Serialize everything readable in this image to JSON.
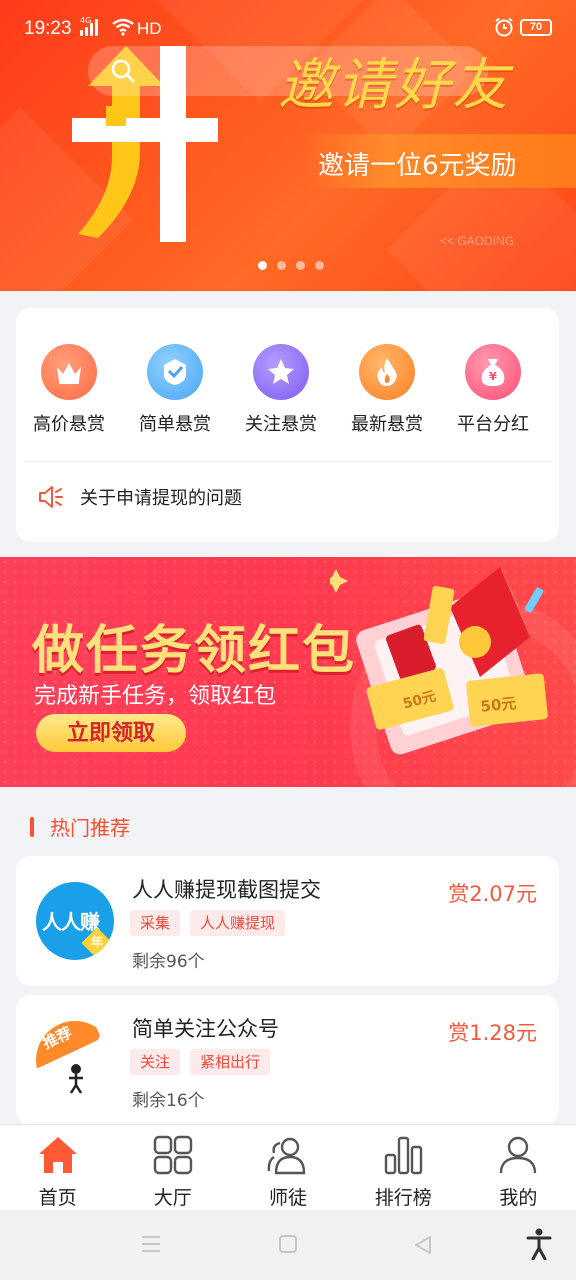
{
  "status_bar": {
    "time": "19:23",
    "network": "4G",
    "hd": "HD",
    "battery": "70"
  },
  "top_banner": {
    "title": "邀请好友",
    "subtitle": "邀请一位6元奖励",
    "watermark": "<< GAODING",
    "slide_count": 4,
    "active_slide": 1
  },
  "categories": [
    {
      "label": "高价悬赏",
      "icon": "crown-icon",
      "color": "#ff6f4a"
    },
    {
      "label": "简单悬赏",
      "icon": "badge-icon",
      "color": "#4aa6f5"
    },
    {
      "label": "关注悬赏",
      "icon": "star-icon",
      "color": "#8a63f0"
    },
    {
      "label": "最新悬赏",
      "icon": "flame-icon",
      "color": "#ff8a2a"
    },
    {
      "label": "平台分红",
      "icon": "money-bag-icon",
      "color": "#ff5a78"
    }
  ],
  "notice": {
    "text": "关于申请提现的问题"
  },
  "promo": {
    "title": "做任务领红包",
    "subtitle": "完成新手任务，领取红包",
    "button": "立即领取",
    "coupon_label": "50元"
  },
  "section": {
    "title": "热门推荐"
  },
  "tasks": [
    {
      "title": "人人赚提现截图提交",
      "reward": "赏2.07元",
      "tags": [
        "采集",
        "人人赚提现"
      ],
      "remain": "剩余96个",
      "avatar_text": "人人赚",
      "avatar_badge": "年"
    },
    {
      "title": "简单关注公众号",
      "reward": "赏1.28元",
      "tags": [
        "关注",
        "紧相出行"
      ],
      "remain": "剩余16个",
      "avatar_text": "推荐"
    }
  ],
  "bottom_nav": [
    {
      "label": "首页",
      "icon": "home-icon",
      "active": true
    },
    {
      "label": "大厅",
      "icon": "grid-icon",
      "active": false
    },
    {
      "label": "师徒",
      "icon": "users-icon",
      "active": false
    },
    {
      "label": "排行榜",
      "icon": "bar-chart-icon",
      "active": false
    },
    {
      "label": "我的",
      "icon": "user-icon",
      "active": false
    }
  ],
  "colors": {
    "accent": "#ff4e2e",
    "reward": "#f15a3c",
    "banner": "#ff5a1f",
    "promo": "#ff3f5a"
  }
}
